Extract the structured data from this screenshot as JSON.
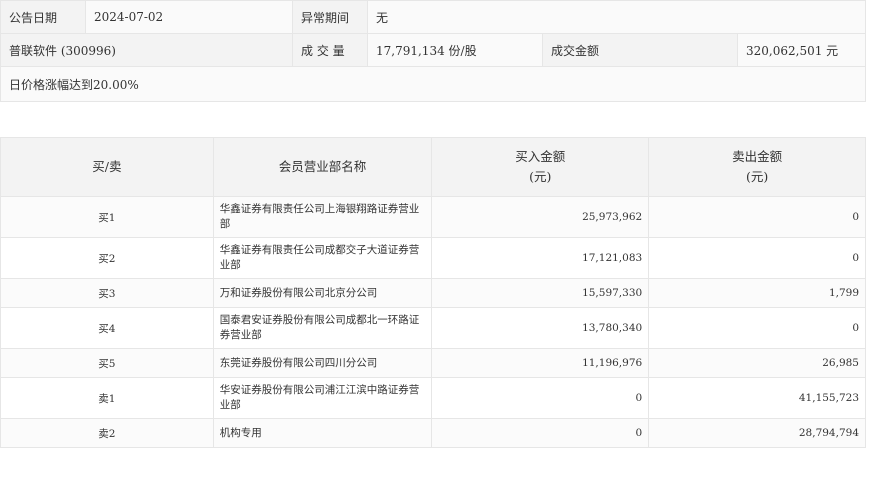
{
  "info": {
    "date_label": "公告日期",
    "date_value": "2024-07-02",
    "period_label": "异常期间",
    "period_value": "无",
    "stock": "普联软件 (300996)",
    "volume_label": "成 交 量",
    "volume_value": "17,791,134 份/股",
    "amount_label": "成交金额",
    "amount_value": "320,062,501 元",
    "reason": "日价格涨幅达到20.00%"
  },
  "table": {
    "headers": {
      "side": "买/卖",
      "name": "会员营业部名称",
      "buy_line1": "买入金额",
      "buy_line2": "(元)",
      "sell_line1": "卖出金额",
      "sell_line2": "(元)"
    },
    "rows": [
      {
        "side": "买1",
        "name": "华鑫证券有限责任公司上海银翔路证券营业部",
        "buy": "25,973,962",
        "sell": "0"
      },
      {
        "side": "买2",
        "name": "华鑫证券有限责任公司成都交子大道证券营业部",
        "buy": "17,121,083",
        "sell": "0"
      },
      {
        "side": "买3",
        "name": "万和证券股份有限公司北京分公司",
        "buy": "15,597,330",
        "sell": "1,799"
      },
      {
        "side": "买4",
        "name": "国泰君安证券股份有限公司成都北一环路证券营业部",
        "buy": "13,780,340",
        "sell": "0"
      },
      {
        "side": "买5",
        "name": "东莞证券股份有限公司四川分公司",
        "buy": "11,196,976",
        "sell": "26,985"
      },
      {
        "side": "卖1",
        "name": "华安证券股份有限公司浦江江滨中路证券营业部",
        "buy": "0",
        "sell": "41,155,723"
      },
      {
        "side": "卖2",
        "name": "机构专用",
        "buy": "0",
        "sell": "28,794,794"
      }
    ]
  }
}
